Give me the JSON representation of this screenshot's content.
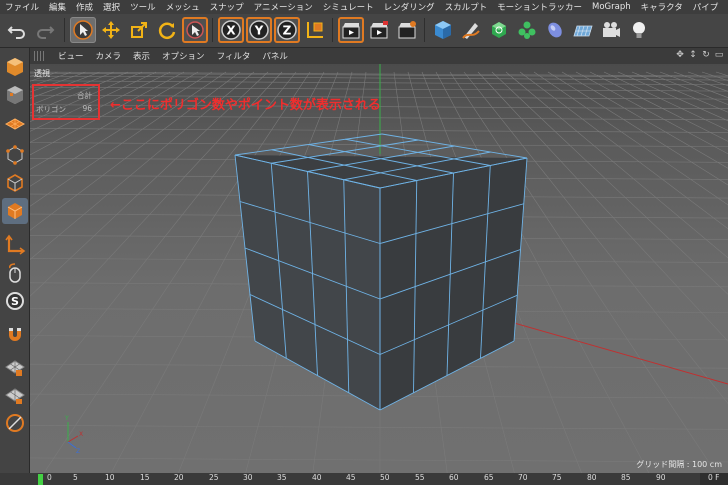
{
  "menu": [
    "ファイル",
    "編集",
    "作成",
    "選択",
    "ツール",
    "メッシュ",
    "スナップ",
    "アニメーション",
    "シミュレート",
    "レンダリング",
    "スカルプト",
    "モーショントラッカー",
    "MoGraph",
    "キャラクタ",
    "パイプ"
  ],
  "toolbar": {
    "axis_x": "X",
    "axis_y": "Y",
    "axis_z": "Z"
  },
  "viewport_menu": [
    "ビュー",
    "カメラ",
    "表示",
    "オプション",
    "フィルタ",
    "パネル"
  ],
  "viewport": {
    "label": "透視",
    "grid_info": "グリッド間隔 : 100 cm"
  },
  "stats": {
    "header": "合計",
    "polygon_label": "ポリゴン",
    "polygon_value": "96"
  },
  "annotation": "←ここにポリゴン数やポイント数が表示される",
  "timeline": {
    "ticks": [
      "0",
      "5",
      "10",
      "15",
      "20",
      "25",
      "30",
      "35",
      "40",
      "45",
      "50",
      "55",
      "60",
      "65",
      "70",
      "75",
      "80",
      "85",
      "90"
    ],
    "end_label": "0 F"
  },
  "colors": {
    "accent_orange": "#e07a22",
    "annotation_red": "#ef2e2e",
    "wire_blue": "#6fb3e6",
    "cube_face": "#3e4144"
  }
}
